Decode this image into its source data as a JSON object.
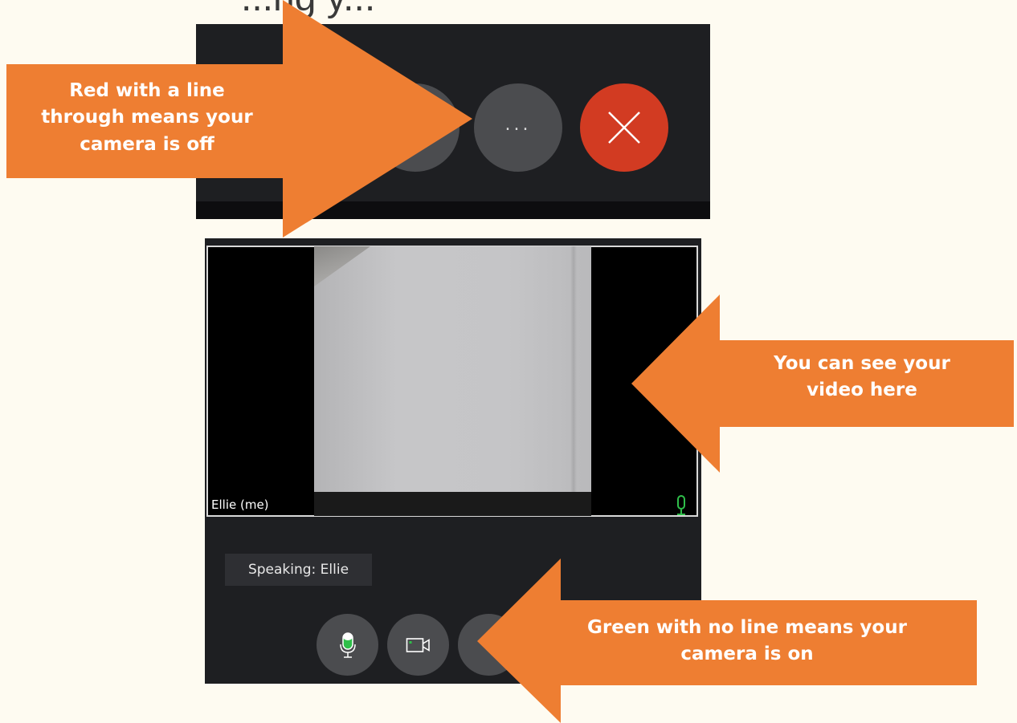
{
  "heading_partial": "...ng y...",
  "top_toolbar": {
    "camera_button": "camera-off",
    "more_button_label": "...",
    "end_call_button": "end-call",
    "camera_off_color": "#e0553d",
    "end_call_color": "#d23b22"
  },
  "video": {
    "participant_name": "Ellie (me)",
    "mic_status_color": "#2fbf4a"
  },
  "speaking_label": "Speaking: Ellie",
  "bottom_toolbar": {
    "mic_button": "mic-on",
    "camera_button": "camera-on",
    "on_color": "#2fbf4a"
  },
  "callouts": {
    "camera_off_line1": "Red with a line",
    "camera_off_line2": "through means your",
    "camera_off_line3": "camera is off",
    "video_line1": "You can see your",
    "video_line2": "video here",
    "camera_on_line1": "Green with no line means your",
    "camera_on_line2": "camera is on"
  },
  "colors": {
    "background": "#fefbf1",
    "callout": "#ee7e32",
    "panel": "#1e1f22"
  }
}
